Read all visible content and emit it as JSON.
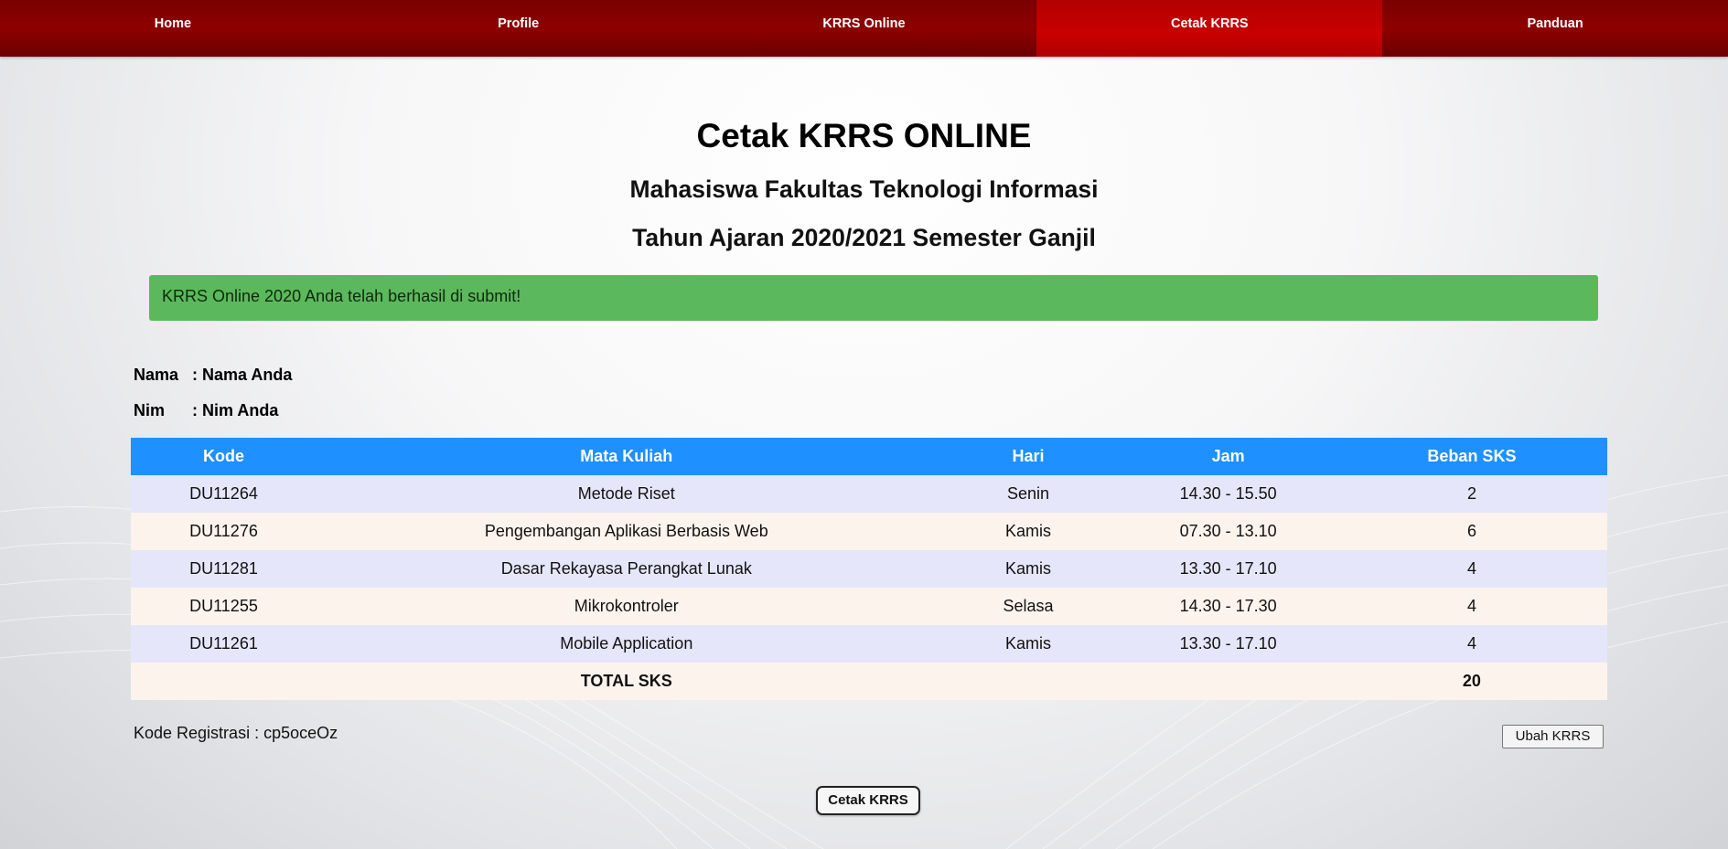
{
  "nav": {
    "items": [
      {
        "label": "Home"
      },
      {
        "label": "Profile"
      },
      {
        "label": "KRRS Online"
      },
      {
        "label": "Cetak KRRS"
      },
      {
        "label": "Panduan"
      }
    ],
    "active": "Cetak KRRS"
  },
  "page": {
    "title": "Cetak KRRS ONLINE",
    "subtitle1": "Mahasiswa Fakultas Teknologi Informasi",
    "subtitle2": "Tahun Ajaran 2020/2021 Semester Ganjil"
  },
  "alert": {
    "message": "KRRS Online 2020 Anda telah berhasil di submit!",
    "color": "#5cb85c"
  },
  "student": {
    "name_label": "Nama",
    "name_value": ": Nama Anda",
    "nim_label": "Nim",
    "nim_value": ": Nim Anda"
  },
  "table": {
    "headers": [
      "Kode",
      "Mata Kuliah",
      "Hari",
      "Jam",
      "Beban SKS"
    ],
    "rows": [
      [
        "DU11264",
        "Metode Riset",
        "Senin",
        "14.30 - 15.50",
        "2"
      ],
      [
        "DU11276",
        "Pengembangan Aplikasi Berbasis Web",
        "Kamis",
        "07.30 - 13.10",
        "6"
      ],
      [
        "DU11281",
        "Dasar Rekayasa Perangkat Lunak",
        "Kamis",
        "13.30 - 17.10",
        "4"
      ],
      [
        "DU11255",
        "Mikrokontroler",
        "Selasa",
        "14.30 - 17.30",
        "4"
      ],
      [
        "DU11261",
        "Mobile Application",
        "Kamis",
        "13.30 - 17.10",
        "4"
      ]
    ],
    "total_label": "TOTAL SKS",
    "total_value": "20",
    "header_color": "#1e90ff"
  },
  "footer": {
    "reg_code": "Kode Registrasi : cp5oceOz",
    "ubah_label": "Ubah KRRS",
    "cetak_label": "Cetak KRRS"
  },
  "colors": {
    "nav": "#8e0000",
    "nav_active": "#c80000"
  }
}
